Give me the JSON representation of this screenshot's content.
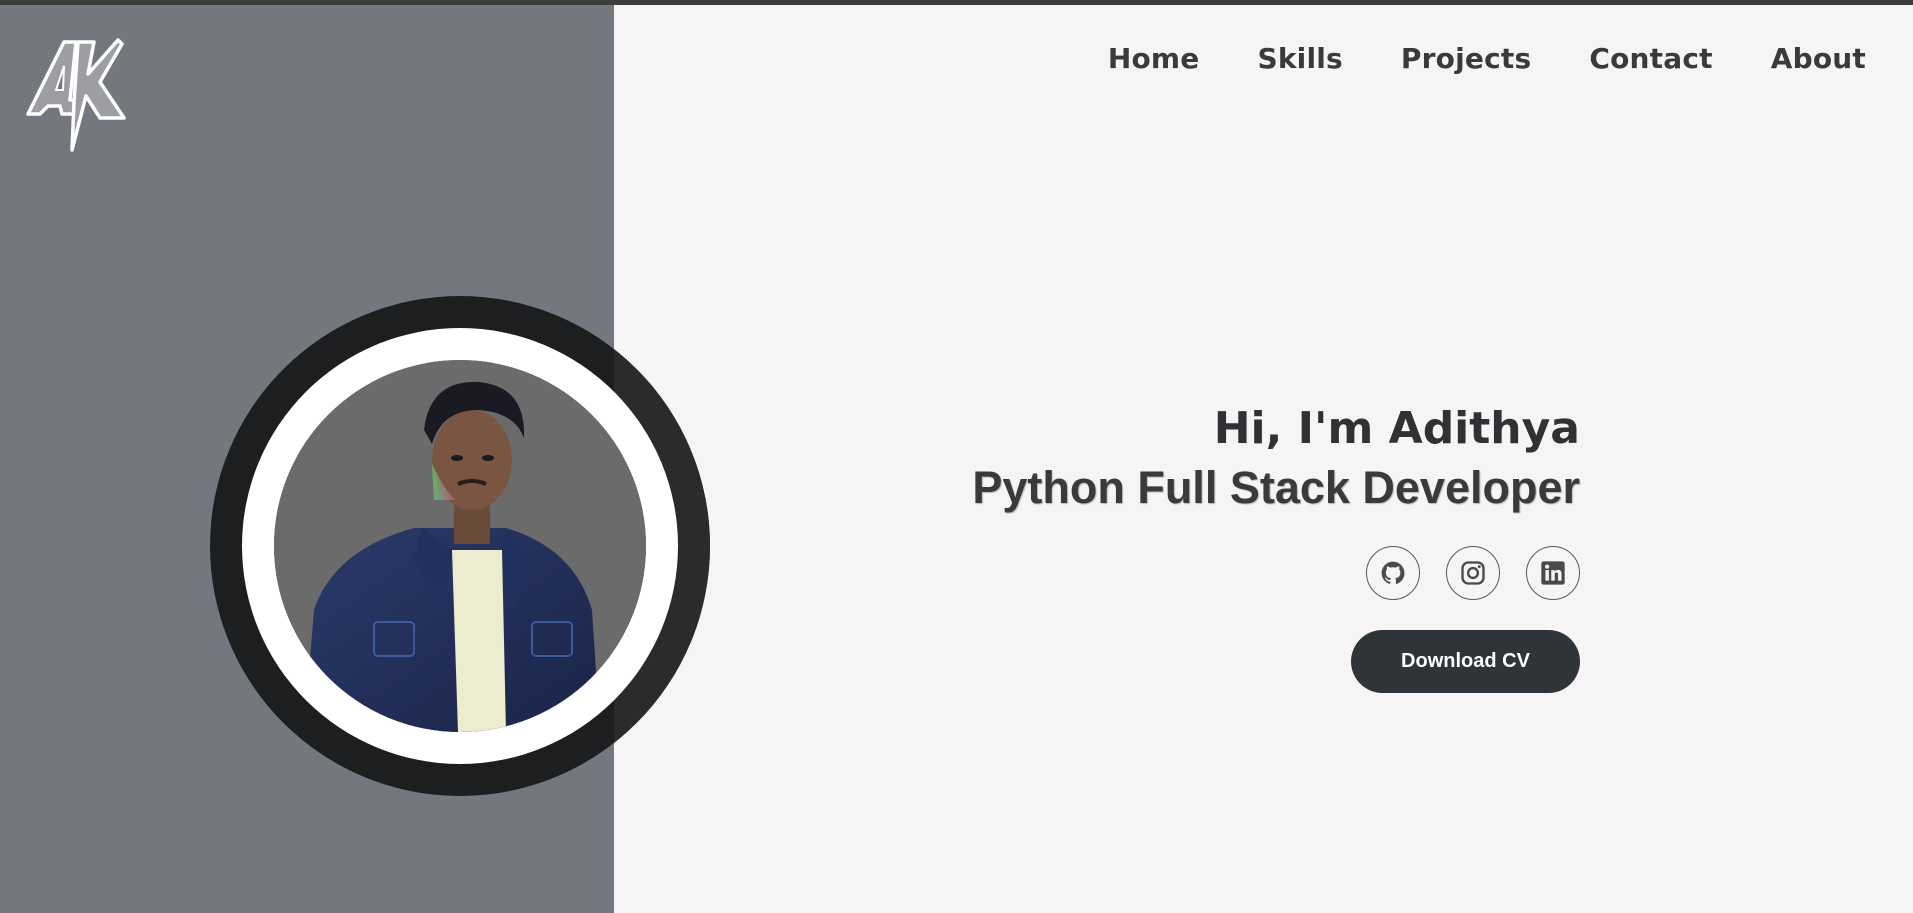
{
  "brand": {
    "logo_text": "AK"
  },
  "nav": {
    "items": [
      {
        "label": "Home"
      },
      {
        "label": "Skills"
      },
      {
        "label": "Projects"
      },
      {
        "label": "Contact"
      },
      {
        "label": "About"
      }
    ]
  },
  "hero": {
    "greeting": "Hi, I'm Adithya",
    "role": "Python Full Stack Developer",
    "cv_button": "Download CV",
    "socials": [
      {
        "icon": "github-icon"
      },
      {
        "icon": "instagram-icon"
      },
      {
        "icon": "linkedin-icon"
      }
    ]
  },
  "colors": {
    "left_panel": "#74787e",
    "page_bg": "#f6f4f4",
    "text_dark": "#2f3135",
    "button_bg": "#2f3438",
    "ring": "#1d1e20"
  }
}
